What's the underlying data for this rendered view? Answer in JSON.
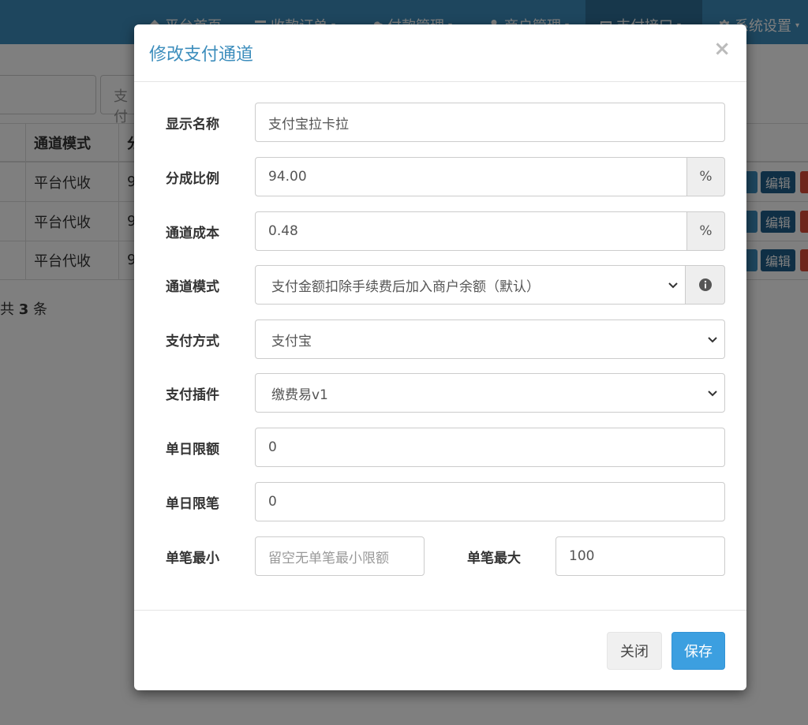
{
  "nav": {
    "items": [
      {
        "label": "平台首页",
        "icon": "home-icon",
        "caret": false
      },
      {
        "label": "收款订单",
        "icon": "list-icon",
        "caret": true
      },
      {
        "label": "付款管理",
        "icon": "cloud-icon",
        "caret": true
      },
      {
        "label": "商户管理",
        "icon": "user-icon",
        "caret": true
      },
      {
        "label": "支付接口",
        "icon": "credit-card-icon",
        "caret": true
      },
      {
        "label": "系统设置",
        "icon": "gear-icon",
        "caret": true
      }
    ],
    "caret_glyph": "▾"
  },
  "background": {
    "search_placeholder": "支付",
    "table": {
      "headers": [
        "通道模式",
        "分"
      ],
      "rows": [
        {
          "mode": "平台代收",
          "ratio": "9",
          "edit": "编辑"
        },
        {
          "mode": "平台代收",
          "ratio": "9",
          "edit": "编辑"
        },
        {
          "mode": "平台代收",
          "ratio": "9",
          "edit": "编辑"
        }
      ]
    },
    "total": {
      "prefix": "共 ",
      "count": "3",
      "suffix": " 条"
    }
  },
  "modal": {
    "title": "修改支付通道",
    "close": "×",
    "fields": {
      "display_name": {
        "label": "显示名称",
        "value": "支付宝拉卡拉"
      },
      "ratio": {
        "label": "分成比例",
        "value": "94.00",
        "addon": "%"
      },
      "cost": {
        "label": "通道成本",
        "value": "0.48",
        "addon": "%"
      },
      "mode": {
        "label": "通道模式",
        "value": "支付金额扣除手续费后加入商户余额（默认）"
      },
      "pay_type": {
        "label": "支付方式",
        "value": "支付宝"
      },
      "plugin": {
        "label": "支付插件",
        "value": "缴费易v1"
      },
      "daily_limit": {
        "label": "单日限额",
        "value": "0"
      },
      "daily_count": {
        "label": "单日限笔",
        "value": "0"
      },
      "min": {
        "label": "单笔最小",
        "value": "",
        "placeholder": "留空无单笔最小限额"
      },
      "max": {
        "label": "单笔最大",
        "value": "100"
      }
    },
    "buttons": {
      "close": "关闭",
      "save": "保存"
    }
  },
  "colors": {
    "brand": "#3c8dbc",
    "primary_button": "#3c9fe0",
    "edit_button": "#1f5f8b"
  }
}
